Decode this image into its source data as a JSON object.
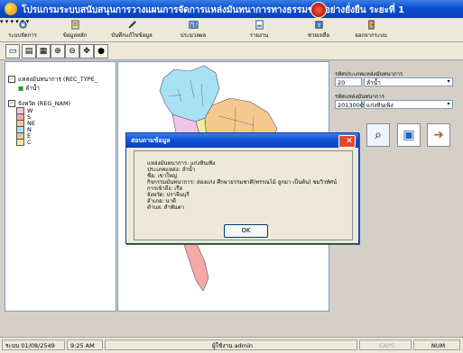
{
  "window": {
    "title": "โปรแกรมระบบสนับสนุนการวางแผนการจัดการแหล่งมันทนาการทางธรรมชาติอย่างยั่งยืน ระยะที่ 1"
  },
  "toolbar": {
    "items": [
      {
        "label": "ระบบจัดการ",
        "icon": "system-icon"
      },
      {
        "label": "ข้อมูลหลัก",
        "icon": "data-icon"
      },
      {
        "label": "บันทึกแก้ไขข้อมูล",
        "icon": "edit-icon"
      },
      {
        "label": "ประมวลผล",
        "icon": "process-icon"
      },
      {
        "label": "รายงาน",
        "icon": "report-icon"
      },
      {
        "label": "ช่วยเหลือ",
        "icon": "help-icon"
      },
      {
        "label": "ออกจากระบบ",
        "icon": "exit-icon"
      }
    ]
  },
  "layers": {
    "group1": {
      "label": "แหล่งมันทนาการ (REC_TYPE_",
      "item": "ลำน้ำ"
    },
    "group2": {
      "label": "จังหวัด (REG_NAM)",
      "items": [
        {
          "code": "W",
          "color": "#f4c3ec"
        },
        {
          "code": "S",
          "color": "#f6a8a8"
        },
        {
          "code": "NE",
          "color": "#f6c88e"
        },
        {
          "code": "N",
          "color": "#a8e0f4"
        },
        {
          "code": "E",
          "color": "#e9c49b"
        },
        {
          "code": "C",
          "color": "#efeca2"
        }
      ]
    }
  },
  "filters": {
    "group_label": "รหัสประเภทแหล่งมันทนาการ",
    "group_code": "20",
    "group_value": "ลำน้ำ",
    "source_label": "รหัสแหล่งมันทนาการ",
    "source_code": "201300005",
    "source_value": "แก่งหินเพิง"
  },
  "dialog": {
    "title": "สอบถามข้อมูล",
    "lines": [
      "แหล่งมันทนาการ: แก่งหินเพิง",
      "ประเภทแหล่ง: ลำน้ำ",
      "ชื่อ: เขาใหญ่",
      "กิจกรรมมันทนาการ: ล่องแก่ง ศึกษาธรรมชาติ(พรรณไม้ ลูกมา เป็นต้น) ชมวิวทัศน์",
      "การเข้าถึง: เรือ",
      "จังหวัด: ปราจีนบุรี",
      "อำเภอ: นาดี",
      "ตำบล: สำพันตา"
    ],
    "ok": "OK"
  },
  "status": {
    "date": "ระบบ 01/08/2549",
    "time": "9:25 AM",
    "user": "ผู้ใช้งาน admin",
    "caps": "CAPS",
    "num": "NUM"
  },
  "colors": {
    "title_blue": "#0b4fd6",
    "north": "#a8e0f4",
    "northeast": "#f6c88e",
    "central": "#efeca2",
    "east": "#e9c49b",
    "west": "#f4c3ec",
    "south": "#f6a8a8"
  }
}
